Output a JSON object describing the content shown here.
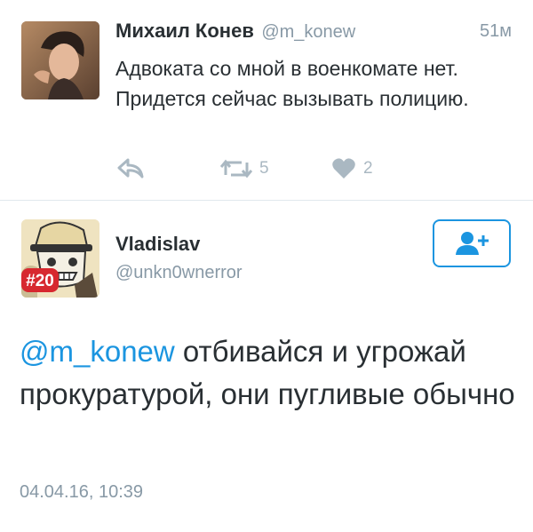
{
  "parent_tweet": {
    "author_name": "Михаил Конев",
    "author_handle": "@m_konew",
    "timestamp": "51м",
    "text": "Адвоката со мной в военкомате нет. Придется сейчас вызывать полицию.",
    "retweet_count": "5",
    "like_count": "2",
    "avatar_icon": "user-photo-avatar"
  },
  "focused_tweet": {
    "author_name": "Vladislav",
    "author_handle": "@unkn0wnerror",
    "avatar_badge": "#20",
    "mention": "@m_konew",
    "text": " отбивайся и угрожай прокуратурой, они пугливые обычно",
    "date": "04.04.16, 10:39",
    "follow_icon": "add-user-icon"
  },
  "colors": {
    "link": "#1b95e0",
    "muted": "#8899a6",
    "action": "#aab8c2",
    "text": "#292f33",
    "badge": "#d7282f"
  }
}
